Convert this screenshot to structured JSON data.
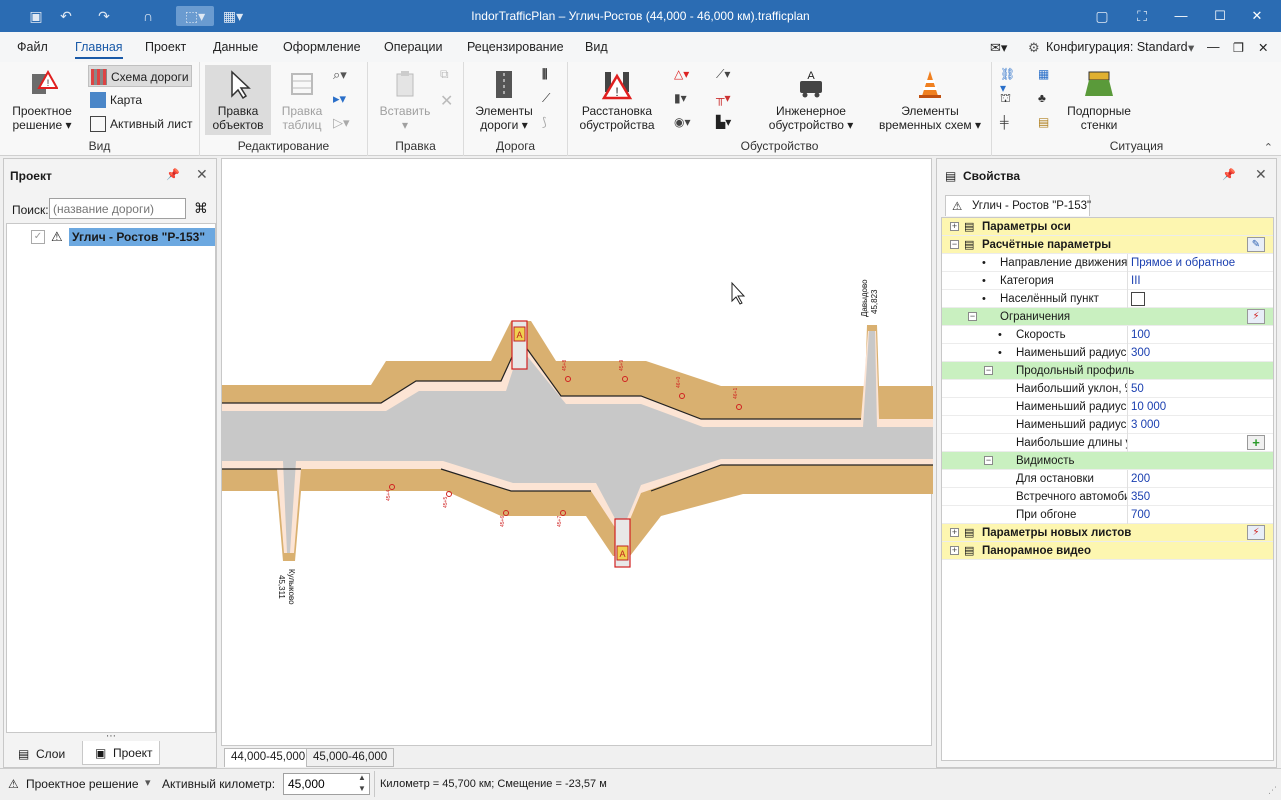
{
  "window": {
    "title": "IndorTrafficPlan – Углич-Ростов (44,000 - 46,000 км).trafficplan"
  },
  "menu": {
    "file": "Файл",
    "home": "Главная",
    "project": "Проект",
    "data": "Данные",
    "design": "Оформление",
    "operations": "Операции",
    "review": "Рецензирование",
    "view": "Вид",
    "config": "Конфигурация: Standard"
  },
  "ribbon": {
    "project_solution": "Проектное",
    "project_solution2": "решение",
    "road_scheme": "Схема дороги",
    "map": "Карта",
    "active_sheet": "Активный лист",
    "group_view": "Вид",
    "edit_objects": "Правка",
    "edit_objects2": "объектов",
    "edit_tables": "Правка",
    "edit_tables2": "таблиц",
    "group_edit": "Редактирование",
    "paste": "Вставить",
    "group_correction": "Правка",
    "road_elements": "Элементы",
    "road_elements2": "дороги",
    "group_road": "Дорога",
    "furnishing": "Расстановка",
    "furnishing2": "обустройства",
    "engineering": "Инженерное",
    "engineering2": "обустройство",
    "temp_schemes": "Элементы",
    "temp_schemes2": "временных схем",
    "group_furnishing": "Обустройство",
    "retaining": "Подпорные",
    "retaining2": "стенки",
    "group_situation": "Ситуация"
  },
  "project_pane": {
    "title": "Проект",
    "search_label": "Поиск:",
    "search_placeholder": "(название дороги)",
    "tree_item": "Углич - Ростов \"Р-153\"",
    "tab_layers": "Слои",
    "tab_project": "Проект"
  },
  "canvas": {
    "label_top_name": "Давыдово",
    "label_top_km": "45,823",
    "label_bot_name": "Кулыково",
    "label_bot_km": "45,311"
  },
  "sheets": [
    "44,000-45,000",
    "45,000-46,000"
  ],
  "props": {
    "title": "Свойства",
    "object_tab": "Углич - Ростов \"Р-153\"",
    "rows": [
      {
        "name": "Параметры оси",
        "value": "",
        "level": 0,
        "kind": "yellow",
        "exp": "+"
      },
      {
        "name": "Расчётные параметры",
        "value": "",
        "level": 0,
        "kind": "yellow",
        "exp": "−"
      },
      {
        "name": "Направление движения",
        "value": "Прямое и обратное",
        "level": 1,
        "kind": "plain"
      },
      {
        "name": "Категория",
        "value": "III",
        "level": 1,
        "kind": "plain"
      },
      {
        "name": "Населённый пункт",
        "value": "",
        "level": 1,
        "kind": "check"
      },
      {
        "name": "Ограничения",
        "value": "",
        "level": 1,
        "kind": "green",
        "exp": "−"
      },
      {
        "name": "Скорость",
        "value": "100",
        "level": 2,
        "kind": "plain"
      },
      {
        "name": "Наименьший радиус",
        "value": "300",
        "level": 2,
        "kind": "plain"
      },
      {
        "name": "Продольный профиль",
        "value": "",
        "level": 2,
        "kind": "green",
        "exp": "−"
      },
      {
        "name": "Наибольший уклон, ‰",
        "value": "50",
        "level": 3,
        "kind": "plain"
      },
      {
        "name": "Наименьший радиус",
        "value": "10 000",
        "level": 3,
        "kind": "plain"
      },
      {
        "name": "Наименьший радиус",
        "value": "3 000",
        "level": 3,
        "kind": "plain"
      },
      {
        "name": "Наибольшие длины уклонов, м",
        "value": "",
        "level": 3,
        "kind": "plain"
      },
      {
        "name": "Видимость",
        "value": "",
        "level": 2,
        "kind": "green",
        "exp": "−"
      },
      {
        "name": "Для остановки",
        "value": "200",
        "level": 3,
        "kind": "plain"
      },
      {
        "name": "Встречного автомобиля",
        "value": "350",
        "level": 3,
        "kind": "plain"
      },
      {
        "name": "При обгоне",
        "value": "700",
        "level": 3,
        "kind": "plain"
      },
      {
        "name": "Параметры новых листов",
        "value": "",
        "level": 0,
        "kind": "yellow",
        "exp": "+"
      },
      {
        "name": "Панорамное видео",
        "value": "",
        "level": 0,
        "kind": "yellow",
        "exp": "+"
      }
    ]
  },
  "status": {
    "solution": "Проектное решение",
    "active_km_label": "Активный километр:",
    "active_km": "45,000",
    "info": "Километр = 45,700 км; Смещение = -23,57 м"
  }
}
